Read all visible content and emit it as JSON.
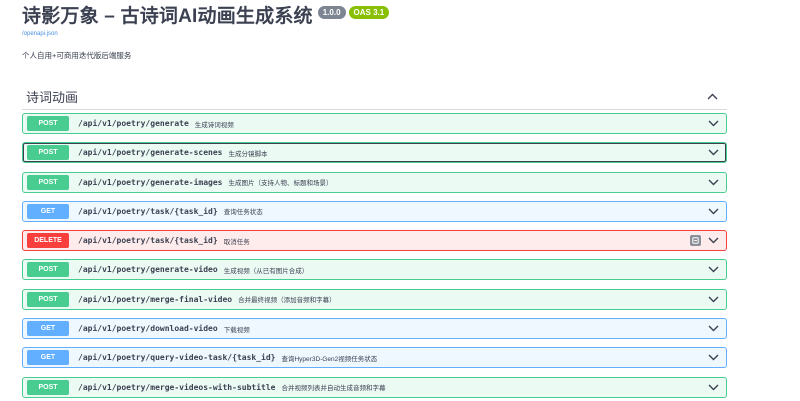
{
  "info": {
    "title": "诗影万象 – 古诗词AI动画生成系统",
    "version": "1.0.0",
    "oas": "OAS 3.1",
    "spec_link": "/openapi.json",
    "description": "个人自用+可商用迭代版后端服务"
  },
  "tag": {
    "name": "诗词动画"
  },
  "operations": [
    {
      "method": "POST",
      "path": "/api/v1/poetry/generate",
      "summary": "生成诗词视频"
    },
    {
      "method": "POST",
      "path": "/api/v1/poetry/generate-scenes",
      "summary": "生成分镜脚本"
    },
    {
      "method": "POST",
      "path": "/api/v1/poetry/generate-images",
      "summary": "生成图片（支持人物、标题和场景）"
    },
    {
      "method": "GET",
      "path": "/api/v1/poetry/task/{task_id}",
      "summary": "查询任务状态"
    },
    {
      "method": "DELETE",
      "path": "/api/v1/poetry/task/{task_id}",
      "summary": "取消任务"
    },
    {
      "method": "POST",
      "path": "/api/v1/poetry/generate-video",
      "summary": "生成视频（从已有图片合成）"
    },
    {
      "method": "POST",
      "path": "/api/v1/poetry/merge-final-video",
      "summary": "合并最终视频（添加音频和字幕）"
    },
    {
      "method": "GET",
      "path": "/api/v1/poetry/download-video",
      "summary": "下载视频"
    },
    {
      "method": "GET",
      "path": "/api/v1/poetry/query-video-task/{task_id}",
      "summary": "查询Hyper3D-Gen2视频任务状态"
    },
    {
      "method": "POST",
      "path": "/api/v1/poetry/merge-videos-with-subtitle",
      "summary": "合并视频列表并自动生成音频和字幕"
    }
  ],
  "colors": {
    "post": "#49cc90",
    "get": "#61affe",
    "delete": "#f93e3e"
  }
}
